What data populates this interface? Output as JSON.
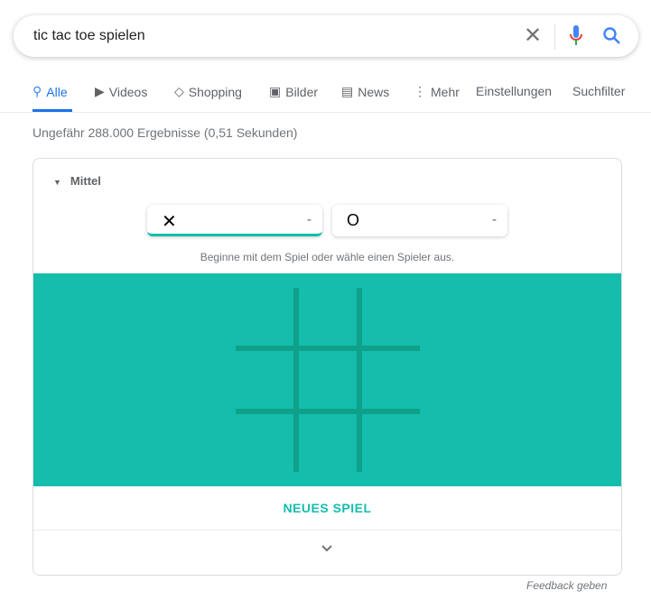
{
  "search": {
    "query": "tic tac toe spielen"
  },
  "tabs": [
    {
      "label": "Alle",
      "icon": "search-icon",
      "active": true
    },
    {
      "label": "Videos",
      "icon": "play-icon"
    },
    {
      "label": "Shopping",
      "icon": "tag-icon"
    },
    {
      "label": "Bilder",
      "icon": "image-icon"
    },
    {
      "label": "News",
      "icon": "news-icon"
    },
    {
      "label": "Mehr",
      "icon": "more-vert-icon"
    },
    {
      "label": "Einstellungen"
    },
    {
      "label": "Suchfilter"
    }
  ],
  "stats": "Ungefähr 288.000 Ergebnisse (0,51 Sekunden)",
  "game": {
    "difficulty": "Mittel",
    "players": [
      {
        "symbol": "✕",
        "score": "-"
      },
      {
        "symbol": "O",
        "score": "-"
      }
    ],
    "hint": "Beginne mit dem Spiel oder wähle einen Spieler aus.",
    "new_game": "NEUES SPIEL",
    "board_color": "#14bdac",
    "accent": "#14bdac"
  },
  "feedback": "Feedback geben"
}
